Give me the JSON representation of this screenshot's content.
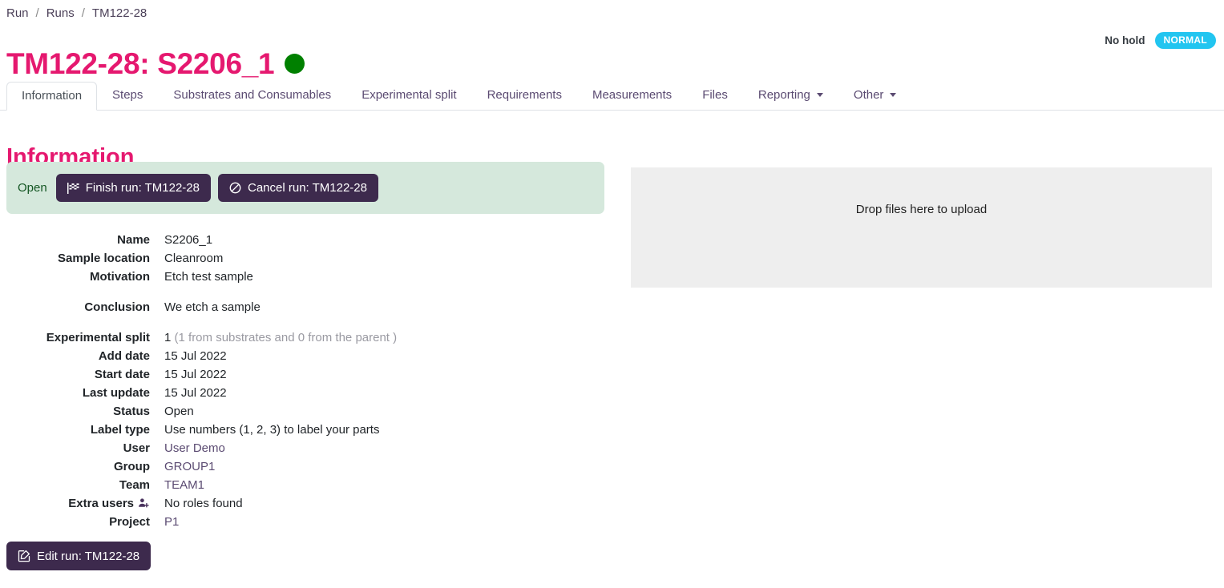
{
  "breadcrumb": {
    "items": [
      "Run",
      "Runs",
      "TM122-28"
    ],
    "separator": "/"
  },
  "header": {
    "title": "TM122-28: S2206_1",
    "status_dot_color": "#008000",
    "hold_status": "No hold",
    "priority_badge": "NORMAL",
    "priority_badge_color": "#22c5f0",
    "title_color": "#e5186f"
  },
  "tabs": [
    {
      "label": "Information",
      "active": true,
      "has_caret": false
    },
    {
      "label": "Steps",
      "active": false,
      "has_caret": false
    },
    {
      "label": "Substrates and Consumables",
      "active": false,
      "has_caret": false
    },
    {
      "label": "Experimental split",
      "active": false,
      "has_caret": false
    },
    {
      "label": "Requirements",
      "active": false,
      "has_caret": false
    },
    {
      "label": "Measurements",
      "active": false,
      "has_caret": false
    },
    {
      "label": "Files",
      "active": false,
      "has_caret": false
    },
    {
      "label": "Reporting",
      "active": false,
      "has_caret": true
    },
    {
      "label": "Other",
      "active": false,
      "has_caret": true
    }
  ],
  "main": {
    "section_title": "Information",
    "action_panel": {
      "state_label": "Open",
      "panel_color": "#d5e8dc",
      "finish_button": "Finish run: TM122-28",
      "cancel_button": "Cancel run: TM122-28"
    },
    "dropzone": {
      "text": "Drop files here to upload"
    },
    "fields": [
      {
        "label": "Name",
        "value": "S2206_1",
        "style": "plain",
        "gap_before": false
      },
      {
        "label": "Sample location",
        "value": "Cleanroom",
        "style": "plain",
        "gap_before": false
      },
      {
        "label": "Motivation",
        "value": "Etch test sample",
        "style": "plain",
        "gap_before": false
      },
      {
        "label": "Conclusion",
        "value": "We etch a sample",
        "style": "plain",
        "gap_before": true
      },
      {
        "label": "Experimental split",
        "value": "1",
        "note": "(1 from substrates and 0 from the parent )",
        "style": "plain",
        "gap_before": true
      },
      {
        "label": "Add date",
        "value": "15 Jul 2022",
        "style": "plain",
        "gap_before": false
      },
      {
        "label": "Start date",
        "value": "15 Jul 2022",
        "style": "plain",
        "gap_before": false
      },
      {
        "label": "Last update",
        "value": "15 Jul 2022",
        "style": "plain",
        "gap_before": false
      },
      {
        "label": "Status",
        "value": "Open",
        "style": "plain",
        "gap_before": false
      },
      {
        "label": "Label type",
        "value": "Use numbers (1, 2, 3) to label your parts",
        "style": "plain",
        "gap_before": false
      },
      {
        "label": "User",
        "value": "User Demo",
        "style": "link",
        "gap_before": false
      },
      {
        "label": "Group",
        "value": "GROUP1",
        "style": "link",
        "gap_before": false
      },
      {
        "label": "Team",
        "value": "TEAM1",
        "style": "link",
        "gap_before": false
      },
      {
        "label": "Extra users",
        "value": "No roles found",
        "style": "plain",
        "icon": "user-plus-icon",
        "gap_before": false
      },
      {
        "label": "Project",
        "value": "P1",
        "style": "link",
        "gap_before": false
      }
    ],
    "edit_button": "Edit run: TM122-28"
  }
}
